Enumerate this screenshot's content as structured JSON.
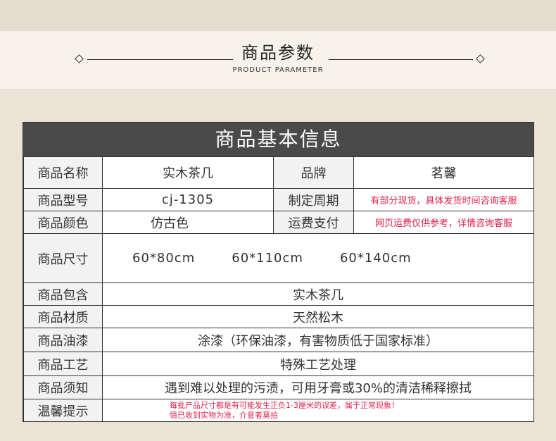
{
  "header": {
    "title_cn": "商品参数",
    "title_en": "PRODUCT PARAMETER"
  },
  "table": {
    "banner": "商品基本信息",
    "rows": {
      "name_label": "商品名称",
      "name_value": "实木茶几",
      "brand_label": "品牌",
      "brand_value": "茗馨",
      "model_label": "商品型号",
      "model_value": "cj-1305",
      "cycle_label": "制定周期",
      "cycle_value": "有部分现货，具体发货时间咨询客服",
      "color_label": "商品颜色",
      "color_value": "仿古色",
      "freight_label": "运费支付",
      "freight_value": "网页运费仅供参考，详情咨询客服",
      "size_label": "商品尺寸",
      "size_1": "60*80cm",
      "size_2": "60*110cm",
      "size_3": "60*140cm",
      "package_label": "商品包含",
      "package_value": "实木茶几",
      "material_label": "商品材质",
      "material_value": "天然松木",
      "paint_label": "商品油漆",
      "paint_value": "涂漆（环保油漆，有害物质低于国家标准）",
      "craft_label": "商品工艺",
      "craft_value": "特殊工艺处理",
      "notice_label": "商品须知",
      "notice_value": "遇到难以处理的污渍，可用牙膏或30%的清洁稀释擦拭",
      "tip_label": "温馨提示",
      "tip_line1": "每批产品尺寸都是有可能发生正负1-3厘米的误差，属于正常现象！",
      "tip_line2": "情已收到实物为准，介意者莫拍"
    }
  },
  "colors": {
    "banner_bg": "#4a4a4a",
    "label_bg": "#f2f2f2",
    "accent_red": "#e0244e"
  }
}
